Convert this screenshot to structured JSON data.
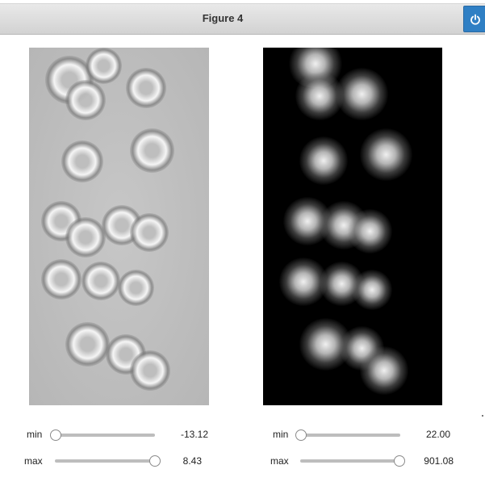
{
  "window": {
    "title": "Figure 4",
    "power_icon": "power-icon",
    "accent": "#2f7fc4"
  },
  "left_panel": {
    "image": "left-filtered-image",
    "min_label": "min",
    "min_value": "-13.12",
    "min_fraction": 0.0,
    "max_label": "max",
    "max_value": "8.43",
    "max_fraction": 1.0
  },
  "right_panel": {
    "image": "right-grayscale-image",
    "min_label": "min",
    "min_value": "22.00",
    "min_fraction": 0.0,
    "max_label": "max",
    "max_value": "901.08",
    "max_fraction": 1.0
  }
}
